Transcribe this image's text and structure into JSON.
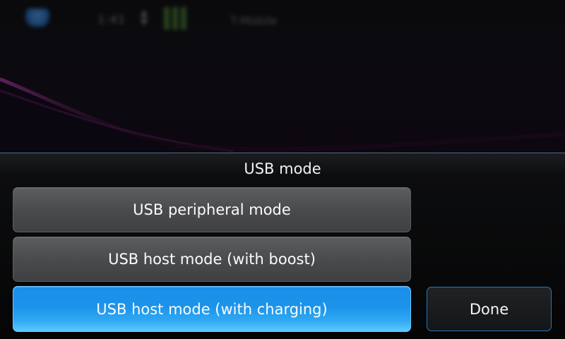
{
  "statusbar": {
    "time": "1:41",
    "operator": "T-Mobile",
    "network_icon": "network-icon",
    "transfer_icon": "updown-arrows-icon",
    "battery_icon": "battery-icon"
  },
  "dialog": {
    "title": "USB mode",
    "options": [
      {
        "label": "USB peripheral mode",
        "selected": false
      },
      {
        "label": "USB host mode (with boost)",
        "selected": false
      },
      {
        "label": "USB host mode (with charging)",
        "selected": true
      }
    ],
    "done_label": "Done"
  },
  "colors": {
    "accent": "#1c93ea",
    "accent_border": "#2a78b8",
    "button_gray": "#4a4b4d",
    "background": "#000000",
    "swoosh": "#6a1f5e"
  }
}
